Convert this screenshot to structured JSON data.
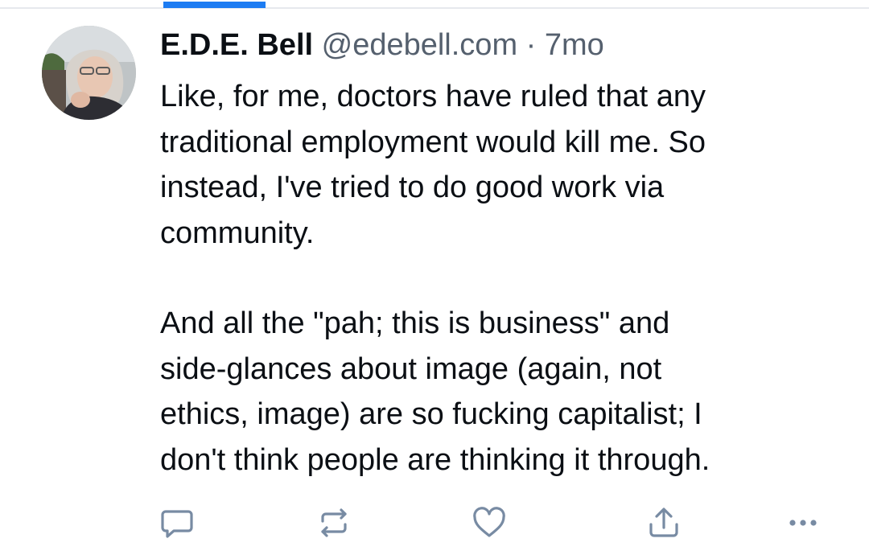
{
  "post": {
    "author": {
      "display_name": "E.D.E. Bell",
      "handle": "@edebell.com",
      "avatar_icon": "profile-photo"
    },
    "separator": "·",
    "timestamp": "7mo",
    "paragraphs": [
      "Like, for me, doctors have ruled that any\ntraditional employment would kill me. So\ninstead, I've tried to do good work via\ncommunity.",
      "And all the \"pah; this is business\" and\nside-glances about image (again, not\nethics, image) are so fucking capitalist; I\ndon't think people are thinking it through."
    ]
  },
  "actions": [
    {
      "name": "reply",
      "icon": "speech-bubble-icon"
    },
    {
      "name": "repost",
      "icon": "repost-arrows-icon"
    },
    {
      "name": "like",
      "icon": "heart-icon"
    },
    {
      "name": "share",
      "icon": "share-upload-icon"
    },
    {
      "name": "more",
      "icon": "ellipsis-icon"
    }
  ],
  "colors": {
    "accent": "#1d7cf2",
    "text": "#0b0f14",
    "muted": "#55606e",
    "icon": "#788ba3"
  }
}
